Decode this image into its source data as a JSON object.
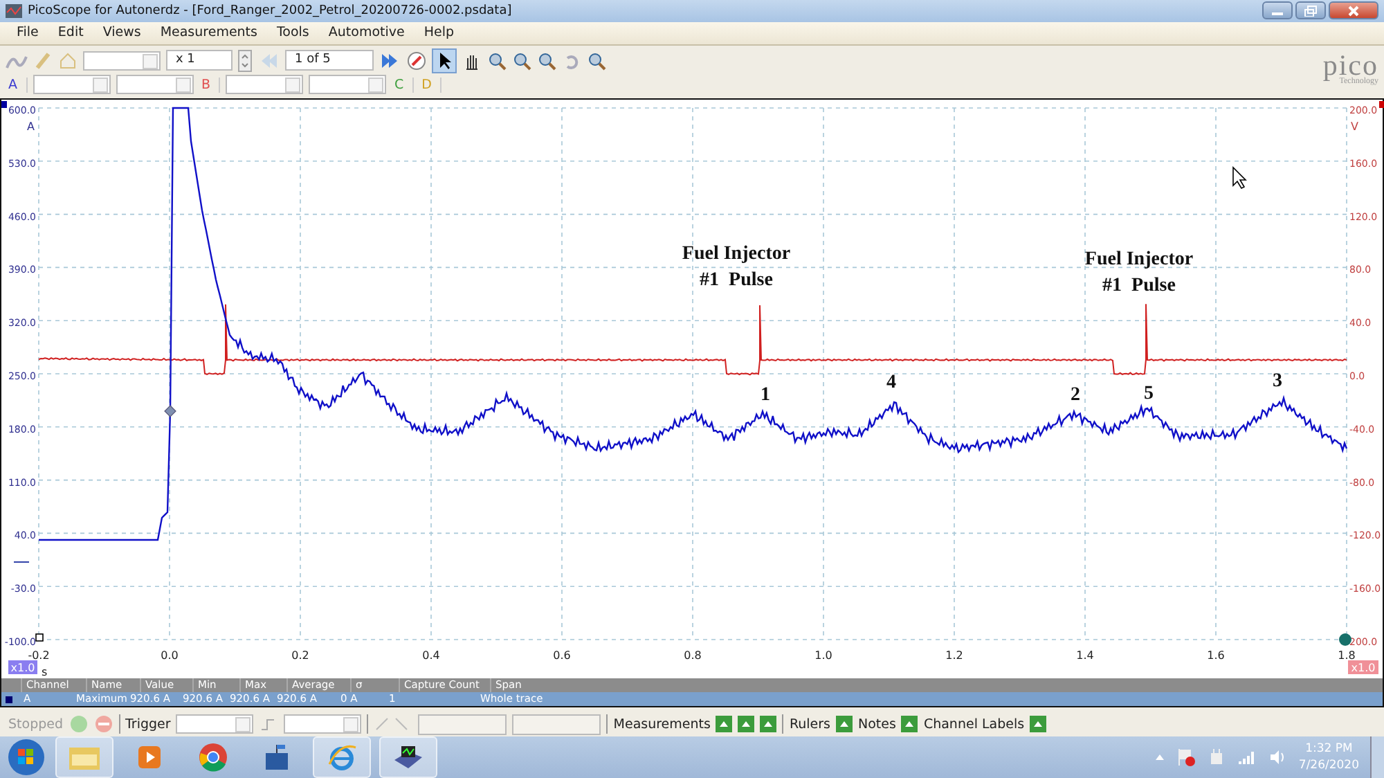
{
  "window": {
    "title": "PicoScope for Autonerdz - [Ford_Ranger_2002_Petrol_20200726-0002.psdata]"
  },
  "menu": [
    "File",
    "Edit",
    "Views",
    "Measurements",
    "Tools",
    "Automotive",
    "Help"
  ],
  "toolbar": {
    "zoom": "x 1",
    "page": "1 of 5"
  },
  "channel_buttons": [
    {
      "label": "A",
      "color": "#3a3ad0"
    },
    {
      "label": "B",
      "color": "#e05050"
    },
    {
      "label": "C",
      "color": "#40a040"
    },
    {
      "label": "D",
      "color": "#d0a020"
    }
  ],
  "logo": {
    "name": "pico",
    "tagline": "Technology"
  },
  "scope": {
    "left_axis": {
      "unit": "A",
      "ticks": [
        "600.0",
        "530.0",
        "460.0",
        "390.0",
        "320.0",
        "250.0",
        "180.0",
        "110.0",
        "40.0",
        "-30.0",
        "-100.0"
      ]
    },
    "right_axis": {
      "unit": "V",
      "ticks": [
        "200.0",
        "160.0",
        "120.0",
        "80.0",
        "40.0",
        "0.0",
        "-40.0",
        "-80.0",
        "-120.0",
        "-160.0",
        "200.0"
      ]
    },
    "x_axis": {
      "unit": "s",
      "ticks": [
        "-0.2",
        "0.0",
        "0.2",
        "0.4",
        "0.6",
        "0.8",
        "1.0",
        "1.2",
        "1.4",
        "1.6",
        "1.8"
      ]
    },
    "left_scale": "x1.0",
    "right_scale": "x1.0",
    "annotations": [
      {
        "lines": [
          "Fuel Injector",
          "#1  Pulse"
        ]
      },
      {
        "lines": [
          "Fuel Injector",
          "#1  Pulse"
        ]
      }
    ],
    "cylinder_marks": [
      "1",
      "4",
      "2",
      "5",
      "3"
    ]
  },
  "measurements": {
    "columns": [
      "Channel",
      "Name",
      "Value",
      "Min",
      "Max",
      "Average",
      "σ",
      "Capture Count",
      "Span"
    ],
    "rows": [
      [
        "A",
        "Maximum",
        "920.6 A",
        "920.6 A",
        "920.6 A",
        "920.6 A",
        "0 A",
        "1",
        "Whole trace"
      ]
    ]
  },
  "status_bar": {
    "state": "Stopped",
    "trigger": "Trigger",
    "items": [
      "Measurements",
      "Rulers",
      "Notes",
      "Channel Labels"
    ]
  },
  "taskbar": {
    "time": "1:32 PM",
    "date": "7/26/2020"
  }
}
